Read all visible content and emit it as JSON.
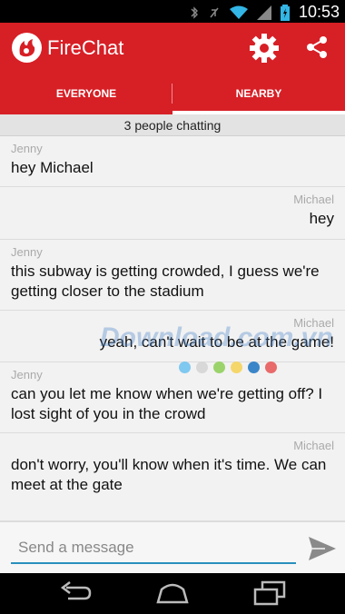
{
  "status_bar": {
    "time": "10:53"
  },
  "app": {
    "title": "FireChat"
  },
  "tabs": [
    {
      "label": "EVERYONE",
      "active": false
    },
    {
      "label": "NEARBY",
      "active": true
    }
  ],
  "count_text": "3 people chatting",
  "messages": [
    {
      "sender": "Jenny",
      "text": "hey Michael",
      "align": "left"
    },
    {
      "sender": "Michael",
      "text": "hey",
      "align": "right"
    },
    {
      "sender": "Jenny",
      "text": "this subway is getting crowded, I guess we're getting closer to the stadium",
      "align": "left"
    },
    {
      "sender": "Michael",
      "text": "yeah, can't wait to be at the game!",
      "align": "right"
    },
    {
      "sender": "Jenny",
      "text": "can you let me know when we're getting off? I lost sight of you in the crowd",
      "align": "left"
    },
    {
      "sender": "Michael",
      "text": "don't worry, you'll know when it's time. We can meet at the gate",
      "align": "left_text_right_sender"
    }
  ],
  "watermark": {
    "text": "Download.com.vn",
    "dot_colors": [
      "#7fc8f0",
      "#d8d8d8",
      "#9bd36b",
      "#f5d66a",
      "#3a86c8",
      "#e86a6a"
    ]
  },
  "composer": {
    "placeholder": "Send a message"
  },
  "colors": {
    "brand_red": "#d71f26",
    "input_accent": "#2a8fbd"
  }
}
